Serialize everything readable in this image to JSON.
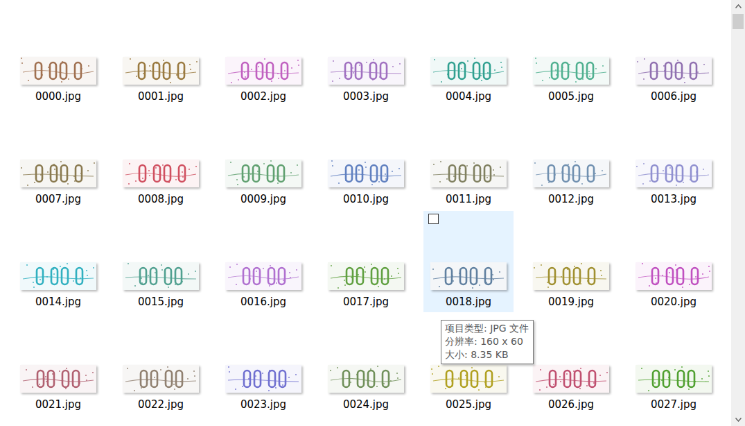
{
  "files": [
    {
      "name": "0000.jpg",
      "selected": false,
      "color": "#a07050"
    },
    {
      "name": "0001.jpg",
      "selected": false,
      "color": "#9a7a40"
    },
    {
      "name": "0002.jpg",
      "selected": false,
      "color": "#c060c0"
    },
    {
      "name": "0003.jpg",
      "selected": false,
      "color": "#a070c0"
    },
    {
      "name": "0004.jpg",
      "selected": false,
      "color": "#30a090"
    },
    {
      "name": "0005.jpg",
      "selected": false,
      "color": "#50b090"
    },
    {
      "name": "0006.jpg",
      "selected": false,
      "color": "#9070b0"
    },
    {
      "name": "0007.jpg",
      "selected": false,
      "color": "#8a7a50"
    },
    {
      "name": "0008.jpg",
      "selected": false,
      "color": "#d05060"
    },
    {
      "name": "0009.jpg",
      "selected": false,
      "color": "#60a070"
    },
    {
      "name": "0010.jpg",
      "selected": false,
      "color": "#6080c0"
    },
    {
      "name": "0011.jpg",
      "selected": false,
      "color": "#808060"
    },
    {
      "name": "0012.jpg",
      "selected": false,
      "color": "#7090b0"
    },
    {
      "name": "0013.jpg",
      "selected": false,
      "color": "#9090d0"
    },
    {
      "name": "0014.jpg",
      "selected": false,
      "color": "#30b0c0"
    },
    {
      "name": "0015.jpg",
      "selected": false,
      "color": "#50a090"
    },
    {
      "name": "0016.jpg",
      "selected": false,
      "color": "#b070d0"
    },
    {
      "name": "0017.jpg",
      "selected": false,
      "color": "#60a040"
    },
    {
      "name": "0018.jpg",
      "selected": true,
      "color": "#6080a0"
    },
    {
      "name": "0019.jpg",
      "selected": false,
      "color": "#a09030"
    },
    {
      "name": "0020.jpg",
      "selected": false,
      "color": "#c050c0"
    },
    {
      "name": "0021.jpg",
      "selected": false,
      "color": "#b06070"
    },
    {
      "name": "0022.jpg",
      "selected": false,
      "color": "#908070"
    },
    {
      "name": "0023.jpg",
      "selected": false,
      "color": "#7070d0"
    },
    {
      "name": "0024.jpg",
      "selected": false,
      "color": "#70905a"
    },
    {
      "name": "0025.jpg",
      "selected": false,
      "color": "#b0a020"
    },
    {
      "name": "0026.jpg",
      "selected": false,
      "color": "#c05070"
    },
    {
      "name": "0027.jpg",
      "selected": false,
      "color": "#50a030"
    }
  ],
  "tooltip": {
    "lines": [
      "项目类型: JPG 文件",
      "分辨率: 160 x 60",
      "大小: 8.35 KB"
    ]
  }
}
